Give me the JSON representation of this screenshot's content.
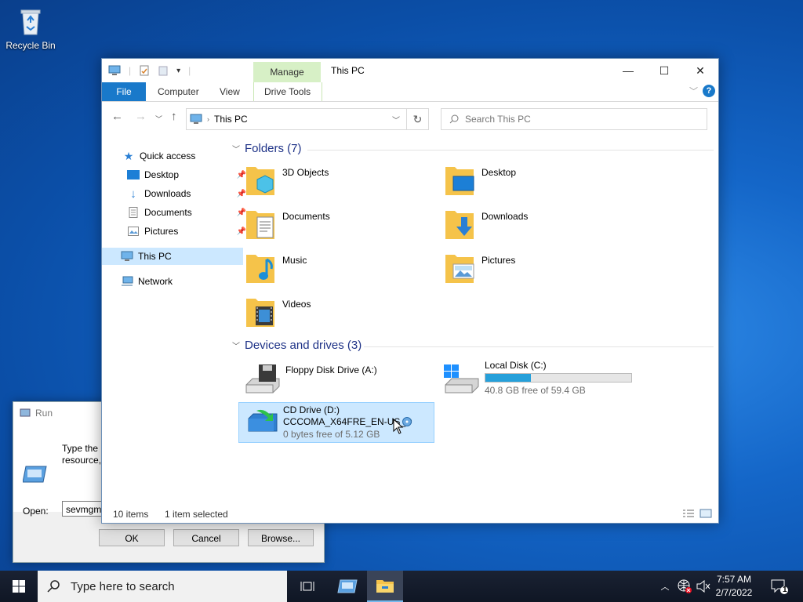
{
  "desktop": {
    "recycle_bin_label": "Recycle Bin"
  },
  "run_dialog": {
    "title": "Run",
    "description_line1": "Type the n",
    "description_line2": "resource,",
    "open_label": "Open:",
    "open_value": "sevmgm",
    "ok_label": "OK",
    "cancel_label": "Cancel",
    "browse_label": "Browse..."
  },
  "explorer": {
    "title": "This PC",
    "manage_tab": "Manage",
    "tabs": {
      "file": "File",
      "computer": "Computer",
      "view": "View",
      "drive_tools": "Drive Tools"
    },
    "help": "?",
    "address": "This PC",
    "search_placeholder": "Search This PC",
    "nav": {
      "quick_access": "Quick access",
      "desktop": "Desktop",
      "downloads": "Downloads",
      "documents": "Documents",
      "pictures": "Pictures",
      "this_pc": "This PC",
      "network": "Network"
    },
    "folders_header": "Folders (7)",
    "folders": [
      "3D Objects",
      "Desktop",
      "Documents",
      "Downloads",
      "Music",
      "Pictures",
      "Videos"
    ],
    "devices_header": "Devices and drives (3)",
    "drives": {
      "floppy": {
        "name": "Floppy Disk Drive (A:)"
      },
      "local": {
        "name": "Local Disk (C:)",
        "free_text": "40.8 GB free of 59.4 GB",
        "used_fraction": 0.313
      },
      "cd": {
        "name": "CD Drive (D:)",
        "label": "CCCOMA_X64FRE_EN-US_D",
        "free_text": "0 bytes free of 5.12 GB"
      }
    },
    "status_items": "10 items",
    "status_selected": "1 item selected"
  },
  "taskbar": {
    "search_placeholder": "Type here to search",
    "time": "7:57 AM",
    "date": "2/7/2022",
    "notification_count": "1"
  }
}
